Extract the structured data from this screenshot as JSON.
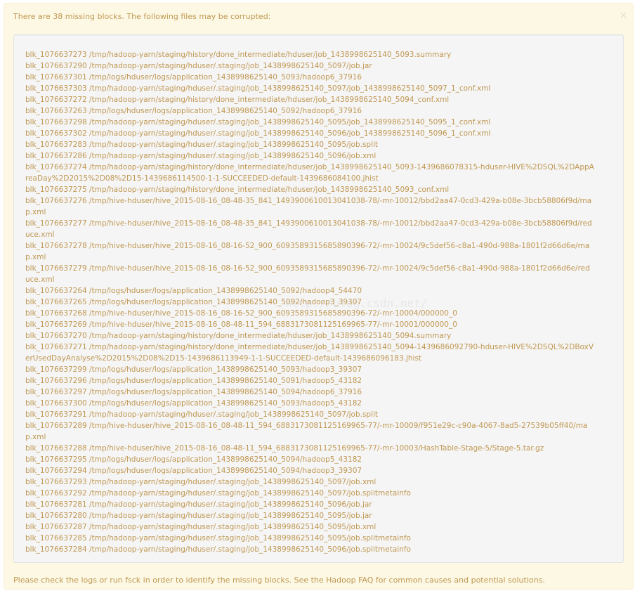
{
  "alert": {
    "title": "There are 38 missing blocks. The following files may be corrupted:",
    "close_glyph": "×",
    "footer": "Please check the logs or run fsck in order to identify the missing blocks. See the Hadoop FAQ for common causes and potential solutions.",
    "watermark": "http://blog.csdn.net/",
    "colors": {
      "background": "#fcf8e3",
      "border": "#fbeed5",
      "text": "#c09853",
      "well_background": "#f5f5f5",
      "well_border": "#e3e3e3"
    }
  },
  "blocks": [
    "blk_1076637273 /tmp/hadoop-yarn/staging/history/done_intermediate/hduser/job_1438998625140_5093.summary",
    "blk_1076637290 /tmp/hadoop-yarn/staging/hduser/.staging/job_1438998625140_5097/job.jar",
    "blk_1076637301 /tmp/logs/hduser/logs/application_1438998625140_5093/hadoop6_37916",
    "blk_1076637303 /tmp/hadoop-yarn/staging/hduser/.staging/job_1438998625140_5097/job_1438998625140_5097_1_conf.xml",
    "blk_1076637272 /tmp/hadoop-yarn/staging/history/done_intermediate/hduser/job_1438998625140_5094_conf.xml",
    "blk_1076637263 /tmp/logs/hduser/logs/application_1438998625140_5092/hadoop6_37916",
    "blk_1076637298 /tmp/hadoop-yarn/staging/hduser/.staging/job_1438998625140_5095/job_1438998625140_5095_1_conf.xml",
    "blk_1076637302 /tmp/hadoop-yarn/staging/hduser/.staging/job_1438998625140_5096/job_1438998625140_5096_1_conf.xml",
    "blk_1076637283 /tmp/hadoop-yarn/staging/hduser/.staging/job_1438998625140_5095/job.split",
    "blk_1076637286 /tmp/hadoop-yarn/staging/hduser/.staging/job_1438998625140_5096/job.xml",
    "blk_1076637274 /tmp/hadoop-yarn/staging/history/done_intermediate/hduser/job_1438998625140_5093-1439686078315-hduser-HIVE%2DSQL%2DAppAreaDay%2D2015%2D08%2D15-1439686114500-1-1-SUCCEEDED-default-1439686084100.jhist",
    "blk_1076637275 /tmp/hadoop-yarn/staging/history/done_intermediate/hduser/job_1438998625140_5093_conf.xml",
    "blk_1076637276 /tmp/hive-hduser/hive_2015-08-16_08-48-35_841_1493900610013041038-78/-mr-10012/bbd2aa47-0cd3-429a-b08e-3bcb58806f9d/map.xml",
    "blk_1076637277 /tmp/hive-hduser/hive_2015-08-16_08-48-35_841_1493900610013041038-78/-mr-10012/bbd2aa47-0cd3-429a-b08e-3bcb58806f9d/reduce.xml",
    "blk_1076637278 /tmp/hive-hduser/hive_2015-08-16_08-16-52_900_6093589315685890396-72/-mr-10024/9c5def56-c8a1-490d-988a-1801f2d66d6e/map.xml",
    "blk_1076637279 /tmp/hive-hduser/hive_2015-08-16_08-16-52_900_6093589315685890396-72/-mr-10024/9c5def56-c8a1-490d-988a-1801f2d66d6e/reduce.xml",
    "blk_1076637264 /tmp/logs/hduser/logs/application_1438998625140_5092/hadoop4_54470",
    "blk_1076637265 /tmp/logs/hduser/logs/application_1438998625140_5092/hadoop3_39307",
    "blk_1076637268 /tmp/hive-hduser/hive_2015-08-16_08-16-52_900_6093589315685890396-72/-mr-10004/000000_0",
    "blk_1076637269 /tmp/hive-hduser/hive_2015-08-16_08-48-11_594_6883173081125169965-77/-mr-10001/000000_0",
    "blk_1076637270 /tmp/hadoop-yarn/staging/history/done_intermediate/hduser/job_1438998625140_5094.summary",
    "blk_1076637271 /tmp/hadoop-yarn/staging/history/done_intermediate/hduser/job_1438998625140_5094-1439686092790-hduser-HIVE%2DSQL%2DBoxVerUsedDayAnalyse%2D2015%2D08%2D15-1439686113949-1-1-SUCCEEDED-default-1439686096183.jhist",
    "blk_1076637299 /tmp/logs/hduser/logs/application_1438998625140_5093/hadoop3_39307",
    "blk_1076637296 /tmp/logs/hduser/logs/application_1438998625140_5091/hadoop5_43182",
    "blk_1076637297 /tmp/logs/hduser/logs/application_1438998625140_5094/hadoop6_37916",
    "blk_1076637300 /tmp/logs/hduser/logs/application_1438998625140_5093/hadoop5_43182",
    "blk_1076637291 /tmp/hadoop-yarn/staging/hduser/.staging/job_1438998625140_5097/job.split",
    "blk_1076637289 /tmp/hive-hduser/hive_2015-08-16_08-48-11_594_6883173081125169965-77/-mr-10009/f951e29c-c90a-4067-8ad5-27539b05ff40/map.xml",
    "blk_1076637288 /tmp/hive-hduser/hive_2015-08-16_08-48-11_594_6883173081125169965-77/-mr-10003/HashTable-Stage-5/Stage-5.tar.gz",
    "blk_1076637295 /tmp/logs/hduser/logs/application_1438998625140_5094/hadoop5_43182",
    "blk_1076637294 /tmp/logs/hduser/logs/application_1438998625140_5094/hadoop3_39307",
    "blk_1076637293 /tmp/hadoop-yarn/staging/hduser/.staging/job_1438998625140_5097/job.xml",
    "blk_1076637292 /tmp/hadoop-yarn/staging/hduser/.staging/job_1438998625140_5097/job.splitmetainfo",
    "blk_1076637281 /tmp/hadoop-yarn/staging/hduser/.staging/job_1438998625140_5096/job.jar",
    "blk_1076637280 /tmp/hadoop-yarn/staging/hduser/.staging/job_1438998625140_5095/job.jar",
    "blk_1076637287 /tmp/hadoop-yarn/staging/hduser/.staging/job_1438998625140_5095/job.xml",
    "blk_1076637285 /tmp/hadoop-yarn/staging/hduser/.staging/job_1438998625140_5095/job.splitmetainfo",
    "blk_1076637284 /tmp/hadoop-yarn/staging/hduser/.staging/job_1438998625140_5096/job.splitmetainfo"
  ]
}
